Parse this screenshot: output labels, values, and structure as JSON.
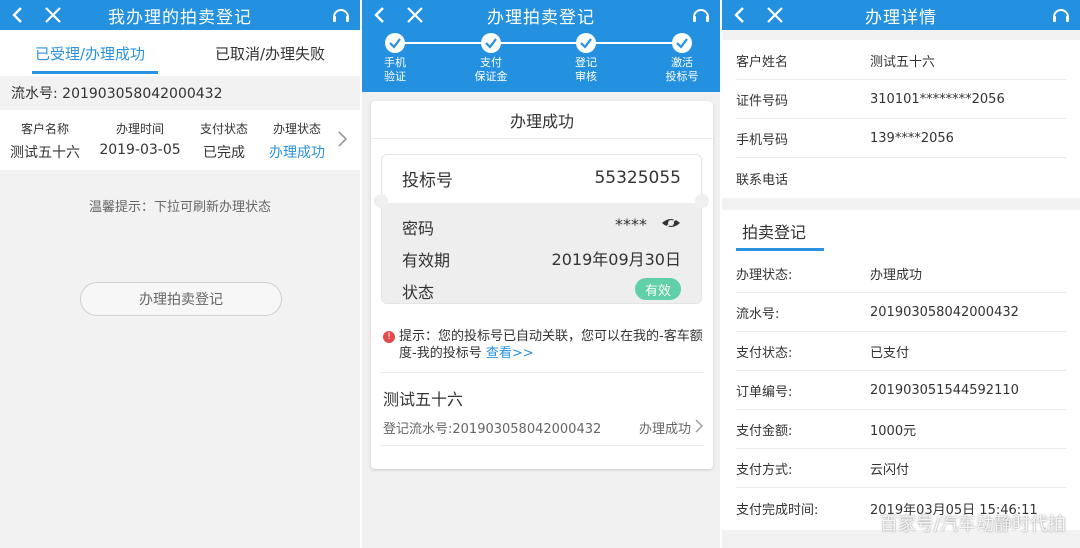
{
  "colors": {
    "primary": "#2490e0",
    "accent": "#2a92e0",
    "badge": "#5fd0a7",
    "warn": "#e04b4b"
  },
  "icons": [
    "back-arrow-icon",
    "close-icon",
    "headset-icon",
    "chevron-right-icon",
    "check-icon",
    "eye-hidden-icon",
    "warning-icon"
  ],
  "p1": {
    "title": "我办理的拍卖登记",
    "tabs": [
      {
        "label": "已受理/办理成功"
      },
      {
        "label": "已取消/办理失败"
      }
    ],
    "serial": "流水号: 201903058042000432",
    "headers": [
      "客户名称",
      "办理时间",
      "支付状态",
      "办理状态"
    ],
    "values": [
      "测试五十六",
      "2019-03-05",
      "已完成",
      "办理成功"
    ],
    "tip": "温馨提示：下拉可刷新办理状态",
    "button": "办理拍卖登记"
  },
  "p2": {
    "title": "办理拍卖登记",
    "steps": [
      {
        "l1": "手机",
        "l2": "验证"
      },
      {
        "l1": "支付",
        "l2": "保证金"
      },
      {
        "l1": "登记",
        "l2": "审核"
      },
      {
        "l1": "激活",
        "l2": "投标号"
      }
    ],
    "card_title": "办理成功",
    "bid_label": "投标号",
    "bid_value": "55325055",
    "pwd_label": "密码",
    "pwd_value": "****",
    "valid_label": "有效期",
    "valid_value": "2019年09月30日",
    "status_label": "状态",
    "status_value": "有效",
    "warn_icon": "!",
    "notice_text": "提示：您的投标号已自动关联，您可以在我的-客车额度-我的投标号",
    "notice_link": "查看>>",
    "name": "测试五十六",
    "reg_serial": "登记流水号:201903058042000432",
    "reg_status": "办理成功"
  },
  "p3": {
    "title": "办理详情",
    "customer": [
      {
        "k": "客户姓名",
        "v": "测试五十六"
      },
      {
        "k": "证件号码",
        "v": "310101********2056"
      },
      {
        "k": "手机号码",
        "v": "139****2056"
      },
      {
        "k": "联系电话",
        "v": ""
      }
    ],
    "section_title": "拍卖登记",
    "details": [
      {
        "k": "办理状态:",
        "v": "办理成功"
      },
      {
        "k": "流水号:",
        "v": "201903058042000432"
      },
      {
        "k": "支付状态:",
        "v": "已支付"
      },
      {
        "k": "订单编号:",
        "v": "201903051544592110"
      },
      {
        "k": "支付金额:",
        "v": "1000元"
      },
      {
        "k": "支付方式:",
        "v": "云闪付"
      },
      {
        "k": "支付完成时间:",
        "v": "2019年03月05日 15:46:11"
      }
    ],
    "watermark": "百家号/汽车动静时代拍"
  }
}
